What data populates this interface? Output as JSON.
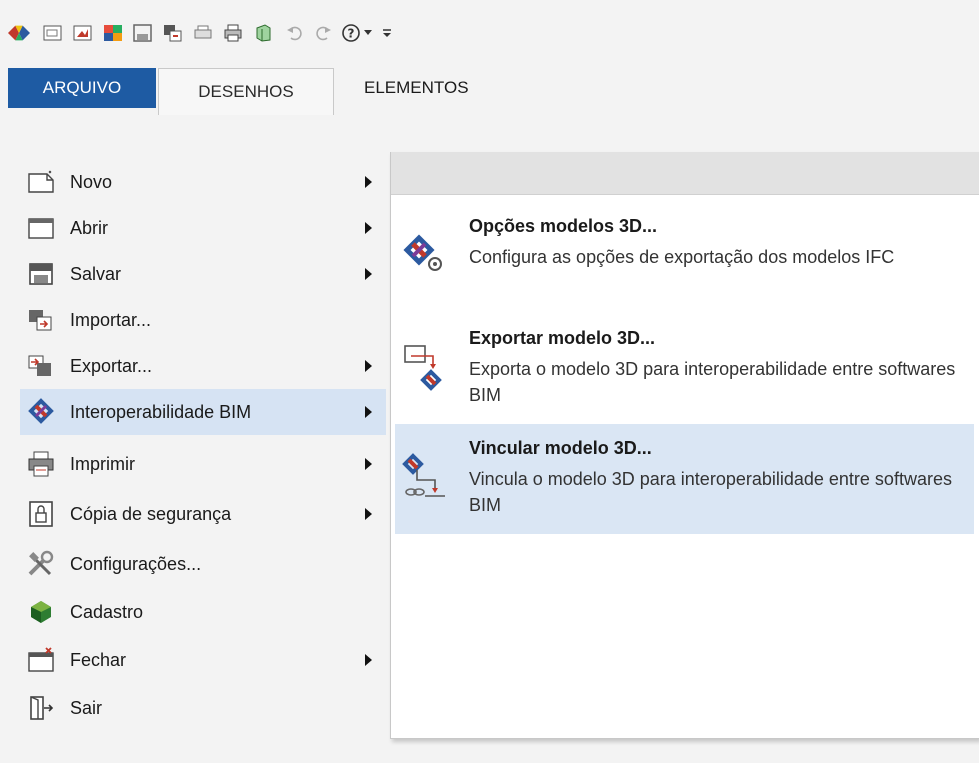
{
  "ribbon": {
    "tabs": [
      {
        "label": "ARQUIVO"
      },
      {
        "label": "DESENHOS"
      },
      {
        "label": "ELEMENTOS"
      }
    ]
  },
  "quick_access": {
    "icons": [
      "app-logo-icon",
      "new-icon",
      "open-icon",
      "color-palette-icon",
      "save-icon",
      "import-icon",
      "print-preview-icon",
      "print-icon",
      "3d-model-icon",
      "undo-icon",
      "redo-icon",
      "help-icon",
      "dropdown-icon",
      "customize-icon"
    ]
  },
  "file_menu": {
    "items": [
      {
        "label": "Novo",
        "icon": "new-file-icon",
        "has_submenu": true
      },
      {
        "label": "Abrir",
        "icon": "open-window-icon",
        "has_submenu": true
      },
      {
        "label": "Salvar",
        "icon": "save-icon",
        "has_submenu": true
      },
      {
        "label": "Importar...",
        "icon": "import-icon",
        "has_submenu": false
      },
      {
        "label": "Exportar...",
        "icon": "export-icon",
        "has_submenu": true
      },
      {
        "label": "Interoperabilidade BIM",
        "icon": "bim-icon",
        "has_submenu": true,
        "active": true
      },
      {
        "label": "Imprimir",
        "icon": "print-icon",
        "has_submenu": true
      },
      {
        "label": "Cópia de segurança",
        "icon": "backup-lock-icon",
        "has_submenu": true
      },
      {
        "label": "Configurações...",
        "icon": "tools-icon",
        "has_submenu": false
      },
      {
        "label": "Cadastro",
        "icon": "registration-icon",
        "has_submenu": false
      },
      {
        "label": "Fechar",
        "icon": "close-window-icon",
        "has_submenu": true
      },
      {
        "label": "Sair",
        "icon": "exit-door-icon",
        "has_submenu": false
      }
    ]
  },
  "submenu": {
    "items": [
      {
        "title": "Opções modelos 3D...",
        "description": "Configura as opções de exportação dos modelos IFC",
        "icon": "bim-settings-icon"
      },
      {
        "title": "Exportar modelo 3D...",
        "description": "Exporta o modelo 3D para interoperabilidade entre softwares BIM",
        "icon": "bim-export-icon"
      },
      {
        "title": "Vincular modelo 3D...",
        "description": "Vincula o modelo 3D para interoperabilidade entre softwares BIM",
        "icon": "bim-link-icon",
        "active": true
      }
    ]
  },
  "colors": {
    "accent": "#1e5ba3",
    "active_item": "#d6e3f3"
  }
}
